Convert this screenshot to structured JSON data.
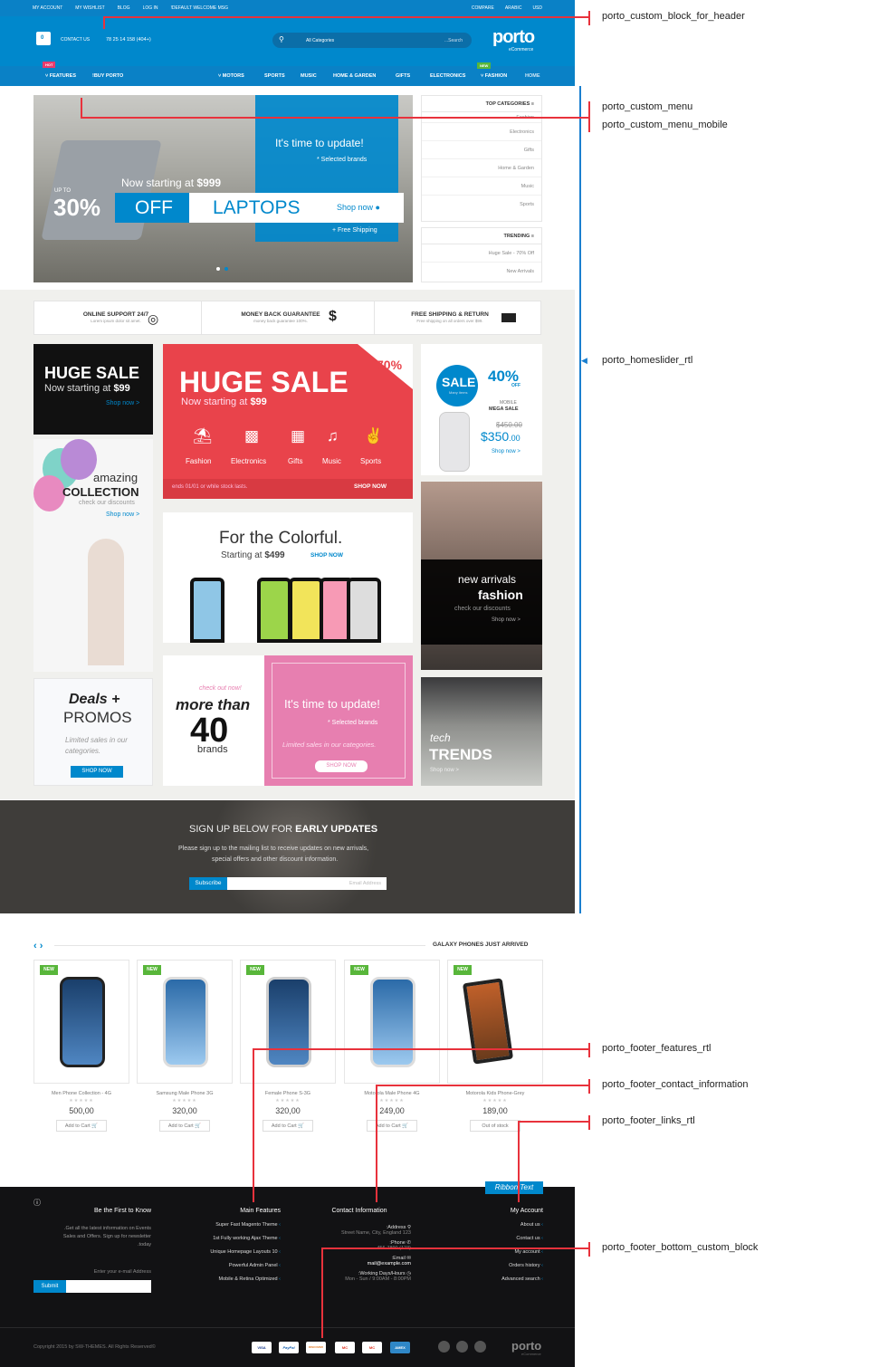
{
  "topbar": {
    "links": [
      "MY ACCOUNT",
      "MY WISHLIST",
      "BLOG",
      "LOG IN",
      "!DEFAULT WELCOME MSG"
    ],
    "compare": "COMPARE",
    "language": "ARABIC",
    "currency": "USD"
  },
  "header": {
    "cart_count": "0",
    "contact_label": "CONTACT US",
    "phone": "78 25 14 158 (404+)",
    "category_select": "All Categories",
    "search_placeholder": "...Search",
    "logo": "porto",
    "logo_sub": "eCommerce"
  },
  "nav": {
    "features": "FEATURES",
    "features_badge": "HOT",
    "buy": "!BUY PORTO",
    "motors": "MOTORS",
    "sports": "SPORTS",
    "music": "MUSIC",
    "home_garden": "HOME & GARDEN",
    "gifts": "GIFTS",
    "electronics": "ELECTRONICS",
    "fashion": "FASHION",
    "fashion_badge": "NEW",
    "home": "HOME"
  },
  "hero": {
    "headline": "It's time to update!",
    "sub": "* Selected brands",
    "starting": "Now starting at",
    "starting_price": "$999",
    "up_to": "UP TO",
    "percent": "30%",
    "off": "OFF",
    "product": "LAPTOPS",
    "shop_now": "Shop now",
    "free_shipping": "+ Free Shipping"
  },
  "sidebar": {
    "top_title": "TOP CATEGORIES",
    "top_items": [
      "Fashion",
      "Electronics",
      "Gifts",
      "Home & Garden",
      "Music",
      "Sports"
    ],
    "trending_title": "TRENDING",
    "trending_items": [
      "Huge Sale - 70% Off",
      "New Arrivals"
    ]
  },
  "features": [
    {
      "title": "ONLINE SUPPORT 24/7",
      "sub": "Lorem ipsum dolor sit amet."
    },
    {
      "title": "MONEY BACK GUARANTEE",
      "sub": "money back guarantee 100%."
    },
    {
      "title": "FREE SHIPPING & RETURN",
      "sub": "Free shipping on all orders over $99."
    }
  ],
  "banners": {
    "huge_dark_title": "HUGE SALE",
    "huge_dark_sub": "Now starting at",
    "huge_dark_price": "$99",
    "huge_dark_shop": "Shop now >",
    "amazing": "amazing",
    "collection": "COLLECTION",
    "check": "check our discounts",
    "amazing_shop": "Shop now >",
    "deals": "Deals +",
    "promos": "PROMOS",
    "limited": "Limited sales in our categories.",
    "deals_btn": "SHOP NOW",
    "sale_pct": "70%",
    "sale_title": "HUGE SALE",
    "sale_sub": "Now starting at",
    "sale_price": "$99",
    "sale_cats": [
      "Fashion",
      "Electronics",
      "Gifts",
      "Music",
      "Sports"
    ],
    "sale_ends": "ends 01/01 or while stock lasts.",
    "sale_btn": "SHOP NOW",
    "colorful": "For the Colorful.",
    "colorful_sub": "Starting at",
    "colorful_price": "$499",
    "colorful_shop": "SHOP NOW",
    "check_out": "check out now!",
    "more_than": "more than",
    "forty": "40",
    "brands": "brands",
    "update": "It's time to update!",
    "selected": "* Selected brands",
    "limited2": "Limited sales in our categories.",
    "update_btn": "SHOP NOW",
    "mobile_sale": "SALE",
    "mobile_sale_sub": "Many items",
    "mobile_pct": "40%",
    "mobile_off": "OFF",
    "mobile_label": "MOBILE",
    "mega": "MEGA SALE",
    "old_price": "$450.00",
    "new_price": "$350",
    "new_price_cents": ".00",
    "mobile_shop": "Shop now >",
    "new_arrivals": "new arrivals",
    "fashion": "fashion",
    "fashion_check": "check our discounts",
    "fashion_shop": "Shop now >",
    "tech": "tech",
    "trends": "TRENDS",
    "tech_shop": "Shop now >"
  },
  "newsletter": {
    "title_a": "SIGN UP BELOW FOR",
    "title_b": "EARLY UPDATES",
    "text1": "Please sign up to the mailing list to receive updates on new arrivals,",
    "text2": "special offers and other discount information.",
    "button": "Subscribe",
    "placeholder": "Email Address"
  },
  "products_section": {
    "title": "GALAXY PHONES JUST ARRIVED",
    "items": [
      {
        "name": "Men Phone Collection - 4G",
        "price": "500,00",
        "btn": "Add to Cart",
        "badge": "NEW"
      },
      {
        "name": "Samsung Male Phone 3G",
        "price": "320,00",
        "btn": "Add to Cart",
        "badge": "NEW"
      },
      {
        "name": "Female Phone S-3G",
        "price": "320,00",
        "btn": "Add to Cart",
        "badge": "NEW"
      },
      {
        "name": "Motorola Male Phone 4G",
        "price": "249,00",
        "btn": "Add to Cart",
        "badge": "NEW"
      },
      {
        "name": "Motorola Kids Phone-Grey",
        "price": "189,00",
        "btn": "Out of stock",
        "badge": "NEW"
      }
    ]
  },
  "footer": {
    "col1_title": "Be the First to Know",
    "col1_text1": ".Get all the latest information on Events",
    "col1_text2": "Sales and Offers. Sign up for newsletter",
    "col1_text3": ".today",
    "col1_placeholder": "Enter your e-mail Address",
    "col1_btn": "Submit",
    "col2_title": "Main Features",
    "col2_items": [
      "Super Fast Magento Theme",
      "1st Fully working Ajax Theme",
      "Unique Homepage Layouts 10",
      "Powerful Admin Panel",
      "Mobile & Retina Optimized"
    ],
    "col3_title": "Contact Information",
    "address_label": ":Address",
    "address": "Street Name, City, England 123",
    "phone_label": ":Phone",
    "phone": "456-7890 (123)",
    "email_label": ":Email",
    "email": "mail@example.com",
    "hours_label": ":Working Days/Hours",
    "hours": "Mon - Sun / 9:00AM - 8:00PM",
    "col4_title": "My Account",
    "col4_items": [
      "About us",
      "Contact us",
      "My account",
      "Orders history",
      "Advanced search"
    ],
    "ribbon": "Ribbon Text",
    "copyright": "Copyright 2015 by SW-THEMES. All Rights Reserved©",
    "cards": [
      "VISA",
      "PayPal",
      "DISCOVER",
      "MC",
      "MC",
      "AMEX"
    ],
    "logo": "porto",
    "logo_sub": "eCommerce"
  },
  "annotations": {
    "a1": "porto_custom_block_for_header",
    "a2": "porto_custom_menu",
    "a3": "porto_custom_menu_mobile",
    "a4": "porto_homeslider_rtl",
    "a5": "porto_footer_features_rtl",
    "a6": "porto_footer_contact_information",
    "a7": "porto_footer_links_rtl",
    "a8": "porto_footer_bottom_custom_block"
  },
  "colors": {
    "primary": "#0088cc",
    "sale_red": "#e9434b",
    "pink": "#e77fb0",
    "annotation_red": "#e8323c"
  }
}
